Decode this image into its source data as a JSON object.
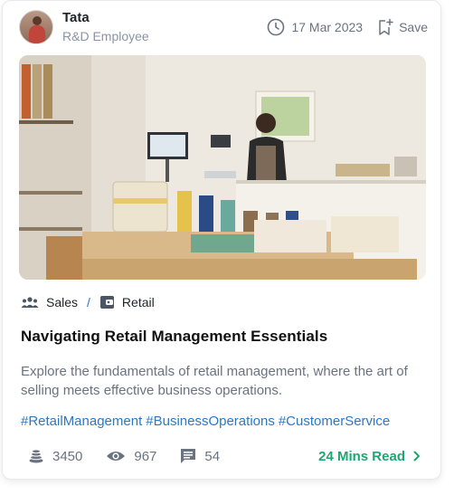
{
  "author": {
    "name": "Tata",
    "role": "R&D Employee"
  },
  "meta": {
    "date": "17 Mar 2023",
    "save_label": "Save"
  },
  "categories": [
    {
      "label": "Sales",
      "icon": "people-icon"
    },
    {
      "label": "Retail",
      "icon": "wallet-icon"
    }
  ],
  "article": {
    "title": "Navigating Retail Management Essentials",
    "description": "Explore the fundamentals of retail management, where the art of selling meets effective business operations.",
    "tags": [
      "#RetailManagement",
      "#BusinessOperations",
      "#CustomerService"
    ]
  },
  "stats": {
    "coins": "3450",
    "views": "967",
    "comments": "54"
  },
  "read_more": "24 Mins Read",
  "colors": {
    "link_blue": "#2b78c5",
    "read_green": "#1ea672",
    "muted": "#6b7280"
  }
}
